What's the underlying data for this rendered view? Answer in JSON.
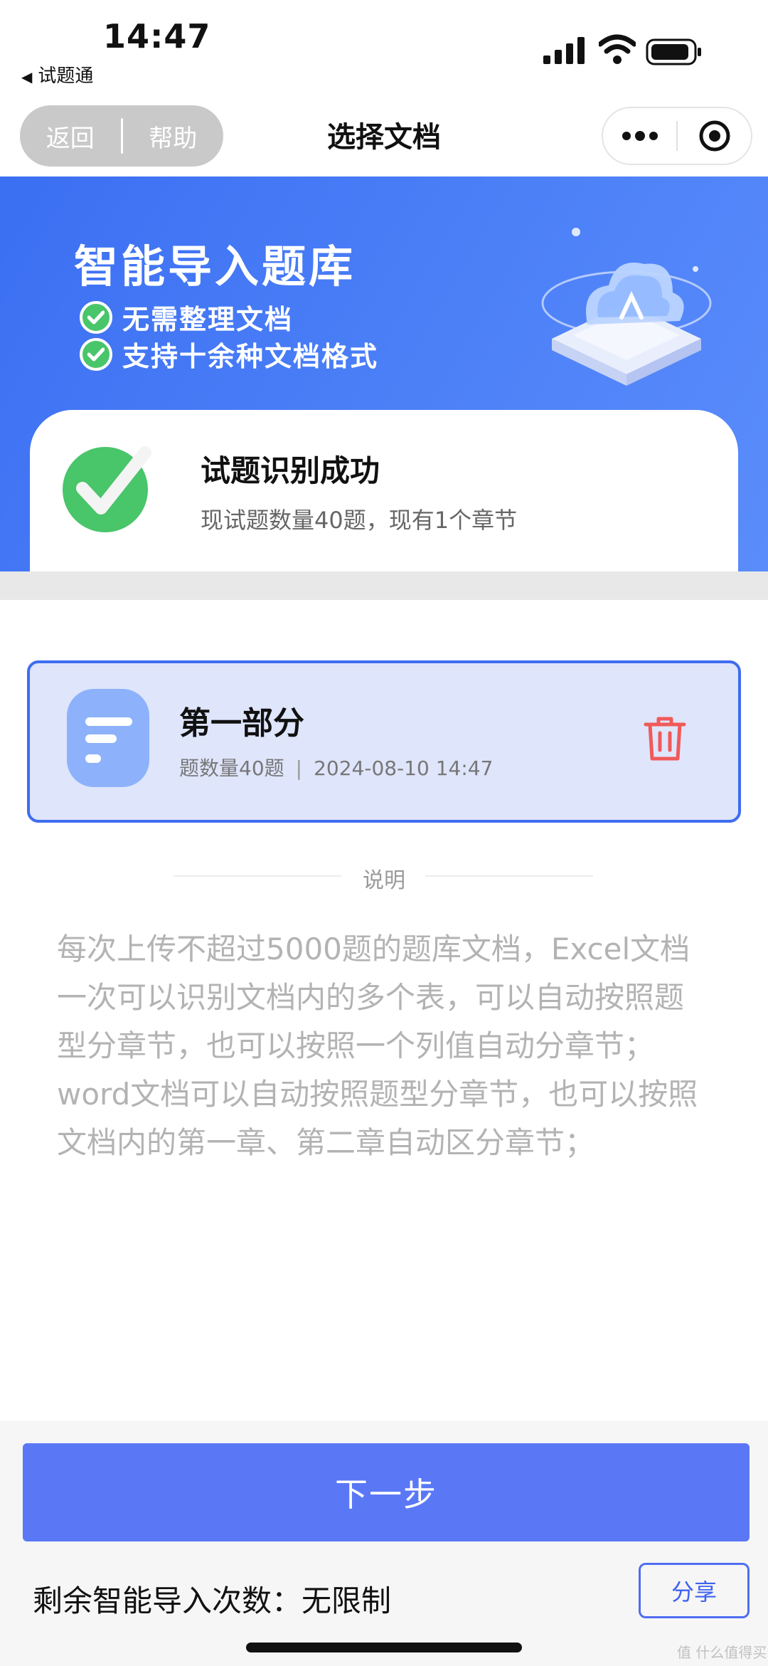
{
  "status_bar": {
    "time": "14:47",
    "back_app": "试题通"
  },
  "nav": {
    "back_label": "返回",
    "help_label": "帮助",
    "title": "选择文档",
    "more_icon": "more-dots-icon",
    "target_icon": "target-icon"
  },
  "banner": {
    "title": "智能导入题库",
    "items": [
      "无需整理文档",
      "支持十余种文档格式"
    ]
  },
  "success": {
    "title": "试题识别成功",
    "subtitle": "现试题数量40题，现有1个章节"
  },
  "document": {
    "title": "第一部分",
    "count": "题数量40题",
    "separator": "|",
    "datetime": "2024-08-10 14:47"
  },
  "note": {
    "label": "说明",
    "text": "每次上传不超过5000题的题库文档，Excel文档一次可以识别文档内的多个表，可以自动按照题型分章节，也可以按照一个列值自动分章节；word文档可以自动按照题型分章节，也可以按照文档内的第一章、第二章自动区分章节；"
  },
  "footer": {
    "next_label": "下一步",
    "remaining": "剩余智能导入次数：无限制",
    "share_label": "分享"
  },
  "watermark": "值 什么值得买",
  "colors": {
    "primary": "#5a78f6",
    "banner": "#4b7ff7",
    "success_green": "#49c56a",
    "danger": "#f05a5a",
    "card_bg": "#dfe5fb",
    "card_border": "#3f6df0"
  }
}
